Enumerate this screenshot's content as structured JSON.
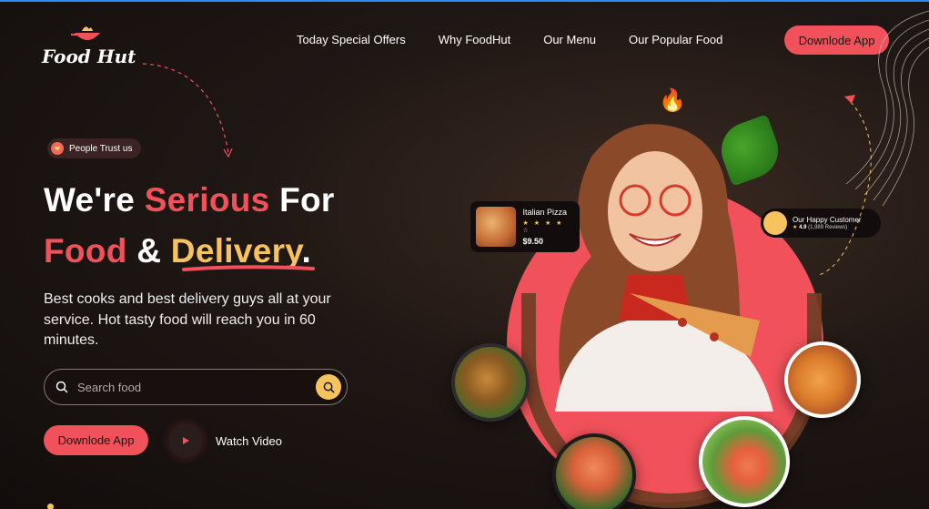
{
  "brand": {
    "name": "Food Hut"
  },
  "nav": {
    "items": [
      "Today Special Offers",
      "Why FoodHut",
      "Our Menu",
      "Our Popular Food"
    ],
    "cta_label": "Downlode App"
  },
  "hero": {
    "badge": "People Trust us",
    "headline": {
      "line1_a": "We're ",
      "line1_b": "Serious",
      "line1_c": " For",
      "line2_a": "Food",
      "line2_b": " & ",
      "line2_c": "Delivery",
      "line2_d": "."
    },
    "description": "Best cooks and best delivery guys all at your service. Hot tasty food will reach you in 60 minutes.",
    "search": {
      "placeholder": "Search food"
    },
    "primary_button": "Downlode App",
    "video_label": "Watch Video"
  },
  "cards": {
    "pizza": {
      "title": "Italian Pizza",
      "stars": "★ ★ ★ ★ ☆",
      "price": "$9.50"
    },
    "customer": {
      "title": "Our Happy Customer",
      "stars": "★",
      "rating": "4.9",
      "reviews": "(1,989 Reviews)"
    }
  },
  "colors": {
    "accent": "#f0515a",
    "highlight": "#f7c35f",
    "background": "#1a1211"
  },
  "icons": [
    "logo-pan-icon",
    "heart-icon",
    "search-icon",
    "play-icon",
    "flame-icon",
    "star-icon"
  ]
}
